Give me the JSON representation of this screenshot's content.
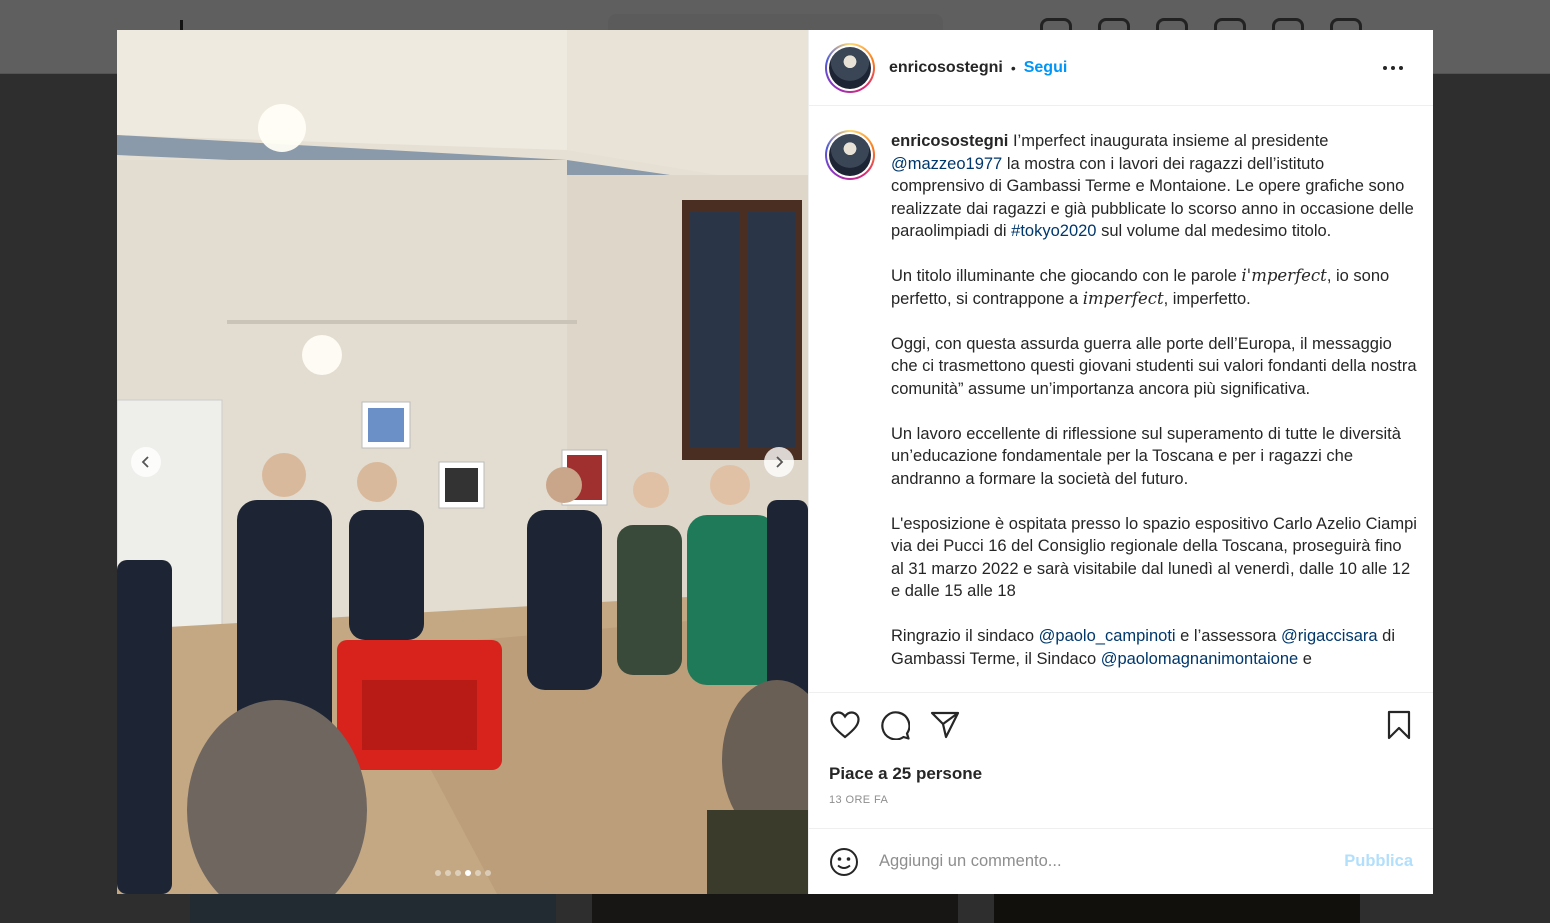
{
  "post": {
    "username": "enricosostegni",
    "separator": "•",
    "follow_label": "Segui",
    "caption": {
      "username": "enricosostegni",
      "segments": [
        {
          "type": "text",
          "text": " I’mperfect inaugurata insieme al presidente "
        },
        {
          "type": "link",
          "text": "@mazzeo1977"
        },
        {
          "type": "text",
          "text": " la mostra con i lavori dei ragazzi dell’istituto comprensivo di Gambassi Terme e Montaione. Le opere grafiche sono realizzate dai ragazzi e già pubblicate lo scorso anno in occasione delle paraolimpiadi di "
        },
        {
          "type": "link",
          "text": "#tokyo2020"
        },
        {
          "type": "text",
          "text": " sul volume dal medesimo titolo.\n\nUn titolo illuminante che giocando con le parole "
        },
        {
          "type": "math",
          "text": "i'mperfect"
        },
        {
          "type": "text",
          "text": ", io sono perfetto, si contrappone a "
        },
        {
          "type": "math",
          "text": "imperfect"
        },
        {
          "type": "text",
          "text": ", imperfetto.\n\nOggi, con questa assurda guerra alle porte dell’Europa, il messaggio che ci trasmettono questi giovani studenti sui valori fondanti della nostra comunità” assume un’importanza ancora più significativa.\n\nUn lavoro eccellente di riflessione sul superamento di tutte le diversità un’educazione fondamentale per la Toscana e per i ragazzi che andranno a formare la società del futuro.\n\nL'esposizione è ospitata presso lo spazio espositivo Carlo Azelio Ciampi via dei Pucci 16 del Consiglio regionale della Toscana, proseguirà fino al 31 marzo 2022 e sarà visitabile dal lunedì al venerdì, dalle 10 alle 12 e dalle 15 alle 18\n\nRingrazio il sindaco "
        },
        {
          "type": "link",
          "text": "@paolo_campinoti"
        },
        {
          "type": "text",
          "text": " e l’assessora "
        },
        {
          "type": "link",
          "text": "@rigaccisara"
        },
        {
          "type": "text",
          "text": " di Gambassi Terme, il Sindaco "
        },
        {
          "type": "link",
          "text": "@paolomagnanimontaione"
        },
        {
          "type": "text",
          "text": " e"
        }
      ]
    },
    "likes_label": "Piace a 25 persone",
    "time_label": "13 ORE FA",
    "comment_placeholder": "Aggiungi un commento...",
    "publish_label": "Pubblica",
    "carousel": {
      "count": 6,
      "active": 3
    }
  },
  "icons": {
    "like": "heart-icon",
    "comment": "comment-icon",
    "share": "paper-plane-icon",
    "save": "bookmark-icon",
    "emoji": "smiley-icon",
    "prev": "chevron-left-icon",
    "next": "chevron-right-icon",
    "more": "more-horizontal-icon"
  },
  "colors": {
    "follow": "#0095f6",
    "link": "#00376b",
    "publish_disabled": "#b2dffc"
  }
}
